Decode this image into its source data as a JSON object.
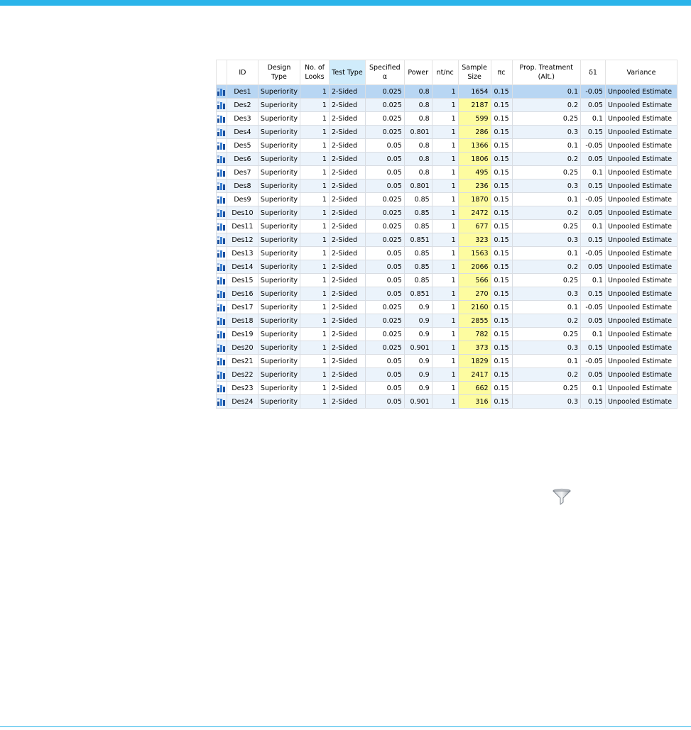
{
  "columns": [
    "",
    "ID",
    "Design Type",
    "No. of Looks",
    "Test Type",
    "Specified α",
    "Power",
    "nt/nc",
    "Sample Size",
    "πc",
    "Prop. Treatment (Alt.)",
    "δ1",
    "Variance"
  ],
  "rows": [
    [
      "Des1",
      "Superiority",
      "1",
      "2-Sided",
      "0.025",
      "0.8",
      "1",
      "1654",
      "0.15",
      "0.1",
      "-0.05",
      "Unpooled Estimate"
    ],
    [
      "Des2",
      "Superiority",
      "1",
      "2-Sided",
      "0.025",
      "0.8",
      "1",
      "2187",
      "0.15",
      "0.2",
      "0.05",
      "Unpooled Estimate"
    ],
    [
      "Des3",
      "Superiority",
      "1",
      "2-Sided",
      "0.025",
      "0.8",
      "1",
      "599",
      "0.15",
      "0.25",
      "0.1",
      "Unpooled Estimate"
    ],
    [
      "Des4",
      "Superiority",
      "1",
      "2-Sided",
      "0.025",
      "0.801",
      "1",
      "286",
      "0.15",
      "0.3",
      "0.15",
      "Unpooled Estimate"
    ],
    [
      "Des5",
      "Superiority",
      "1",
      "2-Sided",
      "0.05",
      "0.8",
      "1",
      "1366",
      "0.15",
      "0.1",
      "-0.05",
      "Unpooled Estimate"
    ],
    [
      "Des6",
      "Superiority",
      "1",
      "2-Sided",
      "0.05",
      "0.8",
      "1",
      "1806",
      "0.15",
      "0.2",
      "0.05",
      "Unpooled Estimate"
    ],
    [
      "Des7",
      "Superiority",
      "1",
      "2-Sided",
      "0.05",
      "0.8",
      "1",
      "495",
      "0.15",
      "0.25",
      "0.1",
      "Unpooled Estimate"
    ],
    [
      "Des8",
      "Superiority",
      "1",
      "2-Sided",
      "0.05",
      "0.801",
      "1",
      "236",
      "0.15",
      "0.3",
      "0.15",
      "Unpooled Estimate"
    ],
    [
      "Des9",
      "Superiority",
      "1",
      "2-Sided",
      "0.025",
      "0.85",
      "1",
      "1870",
      "0.15",
      "0.1",
      "-0.05",
      "Unpooled Estimate"
    ],
    [
      "Des10",
      "Superiority",
      "1",
      "2-Sided",
      "0.025",
      "0.85",
      "1",
      "2472",
      "0.15",
      "0.2",
      "0.05",
      "Unpooled Estimate"
    ],
    [
      "Des11",
      "Superiority",
      "1",
      "2-Sided",
      "0.025",
      "0.85",
      "1",
      "677",
      "0.15",
      "0.25",
      "0.1",
      "Unpooled Estimate"
    ],
    [
      "Des12",
      "Superiority",
      "1",
      "2-Sided",
      "0.025",
      "0.851",
      "1",
      "323",
      "0.15",
      "0.3",
      "0.15",
      "Unpooled Estimate"
    ],
    [
      "Des13",
      "Superiority",
      "1",
      "2-Sided",
      "0.05",
      "0.85",
      "1",
      "1563",
      "0.15",
      "0.1",
      "-0.05",
      "Unpooled Estimate"
    ],
    [
      "Des14",
      "Superiority",
      "1",
      "2-Sided",
      "0.05",
      "0.85",
      "1",
      "2066",
      "0.15",
      "0.2",
      "0.05",
      "Unpooled Estimate"
    ],
    [
      "Des15",
      "Superiority",
      "1",
      "2-Sided",
      "0.05",
      "0.85",
      "1",
      "566",
      "0.15",
      "0.25",
      "0.1",
      "Unpooled Estimate"
    ],
    [
      "Des16",
      "Superiority",
      "1",
      "2-Sided",
      "0.05",
      "0.851",
      "1",
      "270",
      "0.15",
      "0.3",
      "0.15",
      "Unpooled Estimate"
    ],
    [
      "Des17",
      "Superiority",
      "1",
      "2-Sided",
      "0.025",
      "0.9",
      "1",
      "2160",
      "0.15",
      "0.1",
      "-0.05",
      "Unpooled Estimate"
    ],
    [
      "Des18",
      "Superiority",
      "1",
      "2-Sided",
      "0.025",
      "0.9",
      "1",
      "2855",
      "0.15",
      "0.2",
      "0.05",
      "Unpooled Estimate"
    ],
    [
      "Des19",
      "Superiority",
      "1",
      "2-Sided",
      "0.025",
      "0.9",
      "1",
      "782",
      "0.15",
      "0.25",
      "0.1",
      "Unpooled Estimate"
    ],
    [
      "Des20",
      "Superiority",
      "1",
      "2-Sided",
      "0.025",
      "0.901",
      "1",
      "373",
      "0.15",
      "0.3",
      "0.15",
      "Unpooled Estimate"
    ],
    [
      "Des21",
      "Superiority",
      "1",
      "2-Sided",
      "0.05",
      "0.9",
      "1",
      "1829",
      "0.15",
      "0.1",
      "-0.05",
      "Unpooled Estimate"
    ],
    [
      "Des22",
      "Superiority",
      "1",
      "2-Sided",
      "0.05",
      "0.9",
      "1",
      "2417",
      "0.15",
      "0.2",
      "0.05",
      "Unpooled Estimate"
    ],
    [
      "Des23",
      "Superiority",
      "1",
      "2-Sided",
      "0.05",
      "0.9",
      "1",
      "662",
      "0.15",
      "0.25",
      "0.1",
      "Unpooled Estimate"
    ],
    [
      "Des24",
      "Superiority",
      "1",
      "2-Sided",
      "0.05",
      "0.901",
      "1",
      "316",
      "0.15",
      "0.3",
      "0.15",
      "Unpooled Estimate"
    ]
  ],
  "selected_row": 0,
  "highlighted_column": "Test Type",
  "highlighted_cells_column": "Sample Size",
  "row_icon": "design-icon",
  "filter_icon": "filter-funnel-icon",
  "colors": {
    "accent": "#2ab4ea",
    "header_highlight": "#d0ecfb",
    "selected_row": "#b8d6f3",
    "sample_size_fill": "#fdfca0",
    "alt_row": "#ebf3fb"
  }
}
